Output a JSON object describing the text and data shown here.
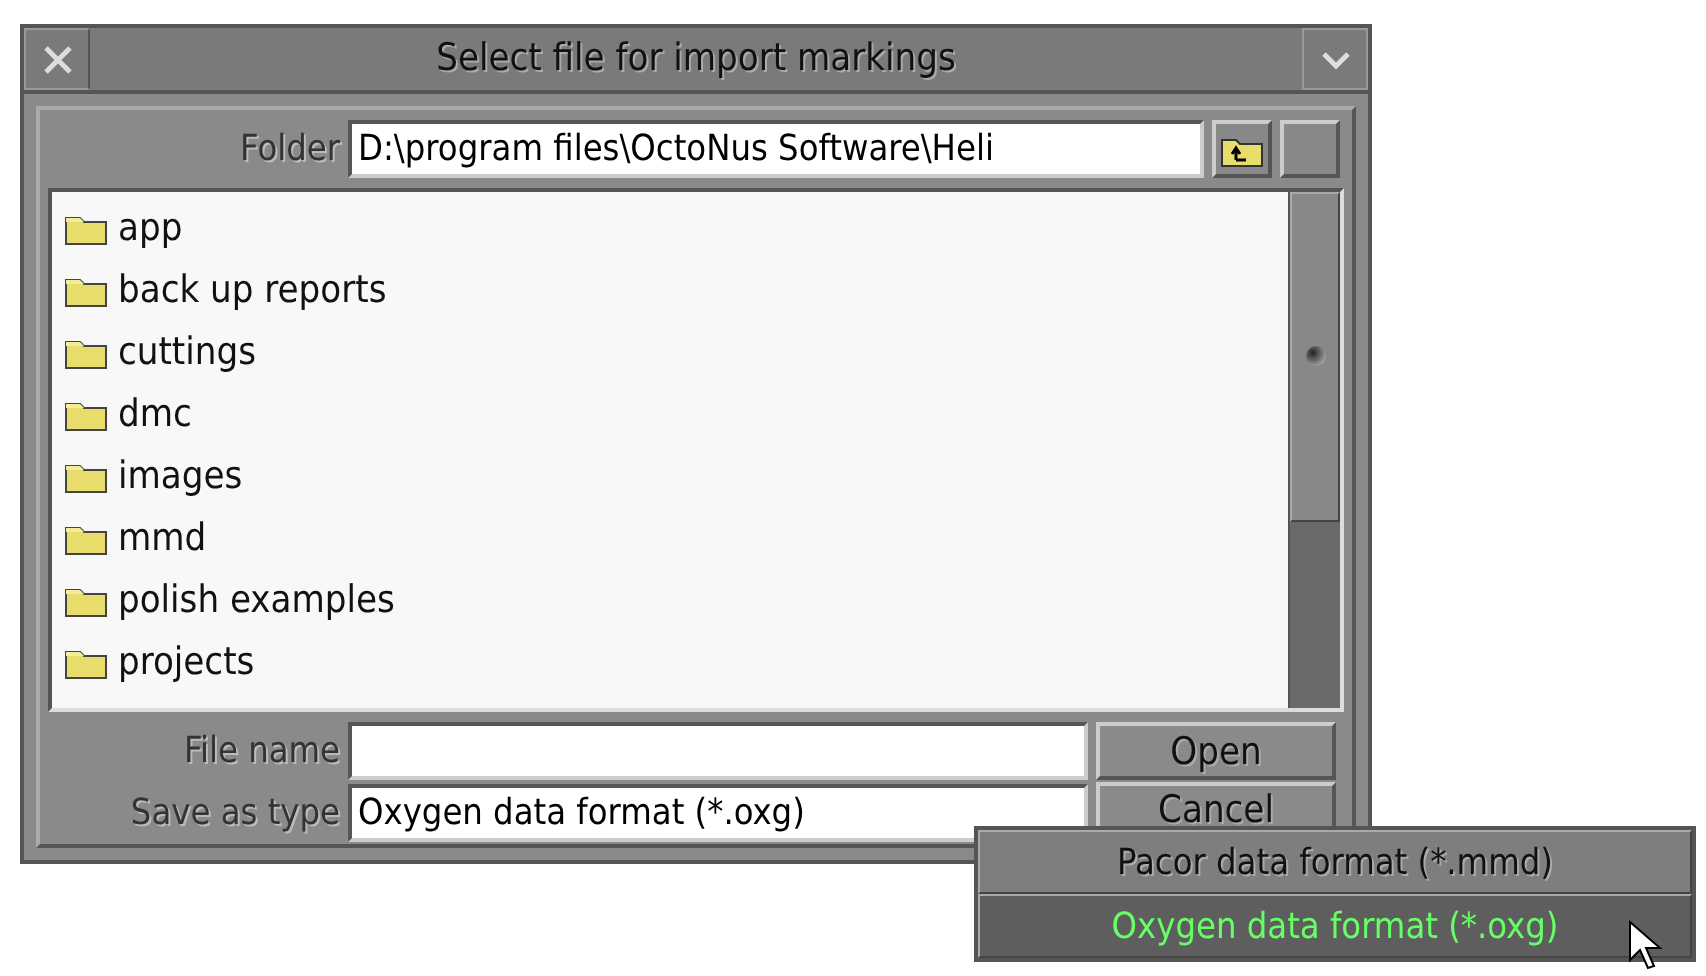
{
  "window": {
    "title": "Select file for import markings"
  },
  "folder": {
    "label": "Folder",
    "value": "D:\\program files\\OctoNus Software\\Heli"
  },
  "files": [
    {
      "name": "app"
    },
    {
      "name": "back up reports"
    },
    {
      "name": "cuttings"
    },
    {
      "name": "dmc"
    },
    {
      "name": "images"
    },
    {
      "name": "mmd"
    },
    {
      "name": "polish examples"
    },
    {
      "name": "projects"
    }
  ],
  "file_name": {
    "label": "File name"
  },
  "save_as_type": {
    "label": "Save as type",
    "value": "Oxygen data format (*.oxg)"
  },
  "buttons": [
    "Open",
    "Cancel"
  ],
  "dropdown": [
    {
      "label": "Pacor data format (*.mmd)",
      "selected": false
    },
    {
      "label": "Oxygen data format (*.oxg)",
      "selected": true
    }
  ]
}
